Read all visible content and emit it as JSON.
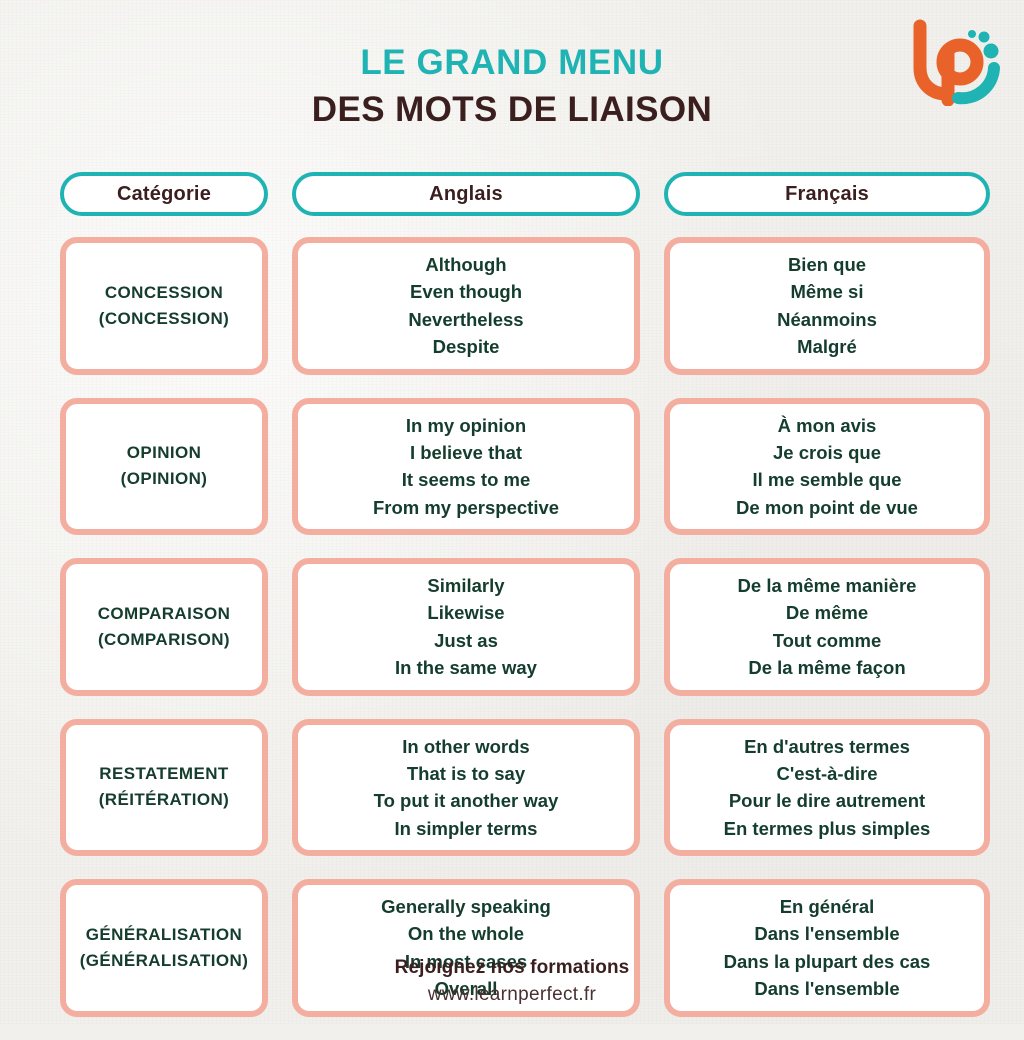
{
  "brand": {
    "logo_icon": "learnperfect-lp-logo-icon",
    "orange": "#E8622A",
    "teal": "#1FB3B3"
  },
  "colors": {
    "background": "#F1F0EC",
    "title_accent": "#1FB3B3",
    "title_dark": "#3B1F1F",
    "card_border": "#F4AEA0",
    "header_border": "#1FB3B3",
    "cell_text": "#153D2E",
    "card_fill": "#FFFFFF"
  },
  "title": {
    "line1": "LE GRAND MENU",
    "line2": "DES MOTS DE LIAISON"
  },
  "table": {
    "headers": [
      "Catégorie",
      "Anglais",
      "Français"
    ],
    "rows": [
      {
        "category_line1": "CONCESSION",
        "category_line2": "(CONCESSION)",
        "english": [
          "Although",
          "Even though",
          "Nevertheless",
          "Despite"
        ],
        "french": [
          "Bien que",
          "Même si",
          "Néanmoins",
          "Malgré"
        ]
      },
      {
        "category_line1": "OPINION",
        "category_line2": "(OPINION)",
        "english": [
          "In my opinion",
          "I believe that",
          "It seems to me",
          "From my perspective"
        ],
        "french": [
          "À mon avis",
          "Je crois que",
          "Il me semble que",
          "De mon point de vue"
        ]
      },
      {
        "category_line1": "COMPARAISON",
        "category_line2": "(COMPARISON)",
        "english": [
          "Similarly",
          "Likewise",
          "Just as",
          "In the same way"
        ],
        "french": [
          "De la même manière",
          "De même",
          "Tout comme",
          "De la même façon"
        ]
      },
      {
        "category_line1": "RESTATEMENT",
        "category_line2": "(RÉITÉRATION)",
        "english": [
          "In other words",
          "That is to say",
          "To put it another way",
          "In simpler terms"
        ],
        "french": [
          "En d'autres termes",
          "C'est-à-dire",
          "Pour le dire autrement",
          "En termes plus simples"
        ]
      },
      {
        "category_line1": "GÉNÉRALISATION",
        "category_line2": "(GÉNÉRALISATION)",
        "english": [
          "Generally speaking",
          "On the whole",
          "In most cases",
          "Overall"
        ],
        "french": [
          "En général",
          "Dans l'ensemble",
          "Dans la plupart des cas",
          "Dans l'ensemble"
        ]
      }
    ]
  },
  "footer": {
    "cta": "Rejoignez nos formations",
    "url": "www.learnperfect.fr"
  }
}
